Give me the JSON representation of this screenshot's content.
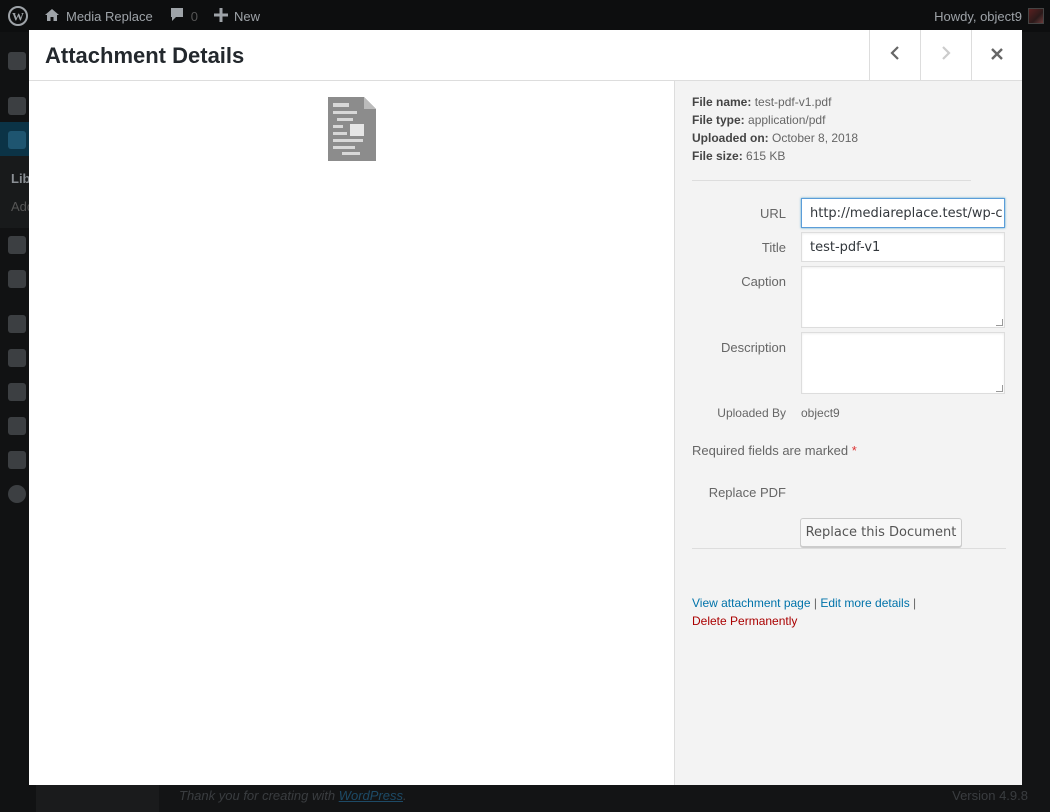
{
  "admin_bar": {
    "site_name": "Media Replace",
    "comments_count": "0",
    "new_label": "New",
    "howdy": "Howdy, object9"
  },
  "admin_sidebar": {
    "library_label": "Lib",
    "add_label": "Add"
  },
  "footer": {
    "thanks_prefix": "Thank you for creating with",
    "thanks_link": "WordPress",
    "thanks_suffix": ".",
    "version": "Version 4.9.8"
  },
  "modal": {
    "title": "Attachment Details",
    "prev_icon": "chevron-left",
    "next_icon": "chevron-right",
    "close_icon": "close"
  },
  "file_info": {
    "name_label": "File name:",
    "name_value": "test-pdf-v1.pdf",
    "type_label": "File type:",
    "type_value": "application/pdf",
    "uploaded_label": "Uploaded on:",
    "uploaded_value": "October 8, 2018",
    "size_label": "File size:",
    "size_value": "615 KB"
  },
  "fields": {
    "url_label": "URL",
    "url_value": "http://mediareplace.test/wp-c",
    "title_label": "Title",
    "title_value": "test-pdf-v1",
    "caption_label": "Caption",
    "caption_value": "",
    "description_label": "Description",
    "description_value": "",
    "uploaded_by_label": "Uploaded By",
    "uploaded_by_value": "object9"
  },
  "required_note": "Required fields are marked",
  "required_mark": "*",
  "replace": {
    "label": "Replace PDF",
    "button": "Replace this Document"
  },
  "actions": {
    "view": "View attachment page",
    "sep1": " | ",
    "edit": "Edit more details",
    "sep2": " |",
    "delete": "Delete Permanently"
  },
  "colors": {
    "link": "#0073aa",
    "delete": "#a00",
    "focus": "#5b9dd9"
  }
}
